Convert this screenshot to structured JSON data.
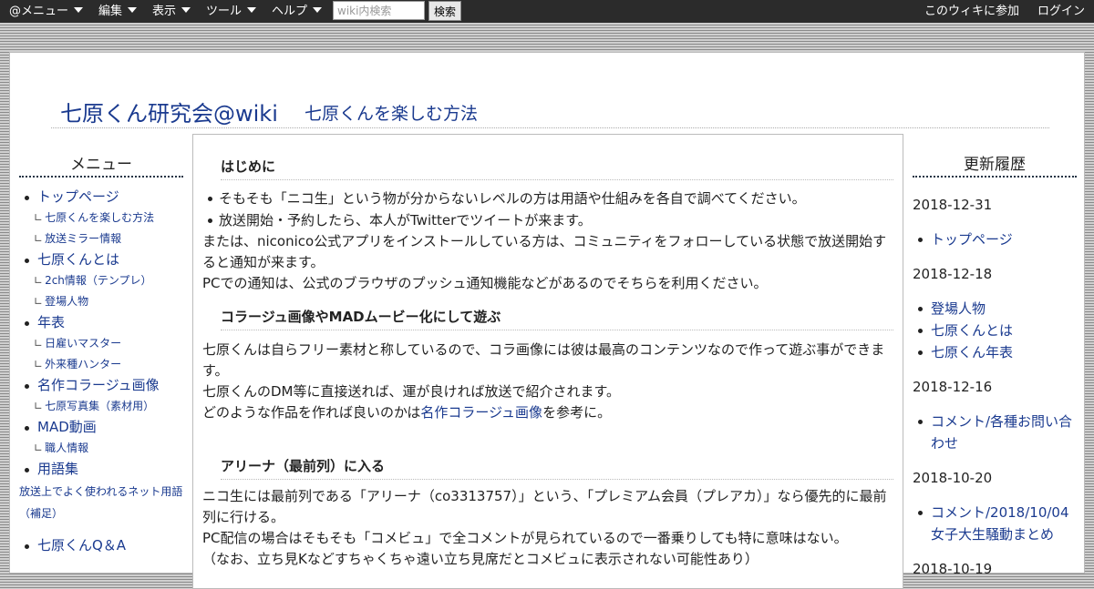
{
  "topbar": {
    "menus": [
      "@メニュー",
      "編集",
      "表示",
      "ツール",
      "ヘルプ"
    ],
    "search_placeholder": "wiki内検索",
    "search_button": "検索",
    "join_link": "このウィキに参加",
    "login_link": "ログイン"
  },
  "header": {
    "site_title": "七原くん研究会@wiki",
    "page_title": "七原くんを楽しむ方法"
  },
  "left_menu": {
    "heading": "メニュー",
    "items": [
      {
        "label": "トップページ",
        "children": [
          "七原くんを楽しむ方法",
          "放送ミラー情報"
        ]
      },
      {
        "label": "七原くんとは",
        "children": [
          "2ch情報（テンプレ）",
          "登場人物"
        ]
      },
      {
        "label": "年表",
        "children": [
          "日雇いマスター",
          "外来種ハンター"
        ]
      },
      {
        "label": "名作コラージュ画像",
        "children": [
          "七原写真集（素材用）"
        ]
      },
      {
        "label": "MAD動画",
        "children": [
          "職人情報"
        ]
      },
      {
        "label": "用語集",
        "children": []
      }
    ],
    "extra_link": "放送上でよく使われるネット用語（補足）",
    "qa_item": "七原くんQ＆A",
    "child_mark": "∟"
  },
  "main": {
    "section1": {
      "heading": "はじめに",
      "bullets": [
        "そもそも「ニコ生」という物が分からないレベルの方は用語や仕組みを各自で調べてください。",
        "放送開始・予約したら、本人がTwitterでツイートが来ます。"
      ],
      "p1": "または、niconico公式アプリをインストールしている方は、コミュニティをフォローしている状態で放送開始すると通知が来ます。",
      "p2": "PCでの通知は、公式のブラウザのプッシュ通知機能などがあるのでそちらを利用ください。"
    },
    "section2": {
      "heading": "コラージュ画像やMADムービー化にして遊ぶ",
      "p1": "七原くんは自らフリー素材と称しているので、コラ画像には彼は最高のコンテンツなので作って遊ぶ事ができます。",
      "p2": "七原くんのDM等に直接送れば、運が良ければ放送で紹介されます。",
      "p3_pre": "どのような作品を作れば良いのかは",
      "p3_link": "名作コラージュ画像",
      "p3_post": "を参考に。"
    },
    "section3": {
      "heading": "アリーナ（最前列）に入る",
      "p1": "ニコ生には最前列である「アリーナ（co3313757）」という、「プレミアム会員（プレアカ）」なら優先的に最前列に行ける。",
      "p2": "PC配信の場合はそもそも「コメビュ」で全コメントが見られているので一番乗りしても特に意味はない。",
      "p3": "（なお、立ち見Kなどすちゃくちゃ遠い立ち見席だとコメビュに表示されない可能性あり）"
    }
  },
  "right_history": {
    "heading": "更新履歴",
    "groups": [
      {
        "date": "2018-12-31",
        "items": [
          "トップページ"
        ]
      },
      {
        "date": "2018-12-18",
        "items": [
          "登場人物",
          "七原くんとは",
          "七原くん年表"
        ]
      },
      {
        "date": "2018-12-16",
        "items": [
          "コメント/各種お問い合わせ"
        ]
      },
      {
        "date": "2018-10-20",
        "items": [
          "コメント/2018/10/04　女子大生騒動まとめ"
        ]
      },
      {
        "date": "2018-10-19",
        "items": []
      }
    ]
  }
}
